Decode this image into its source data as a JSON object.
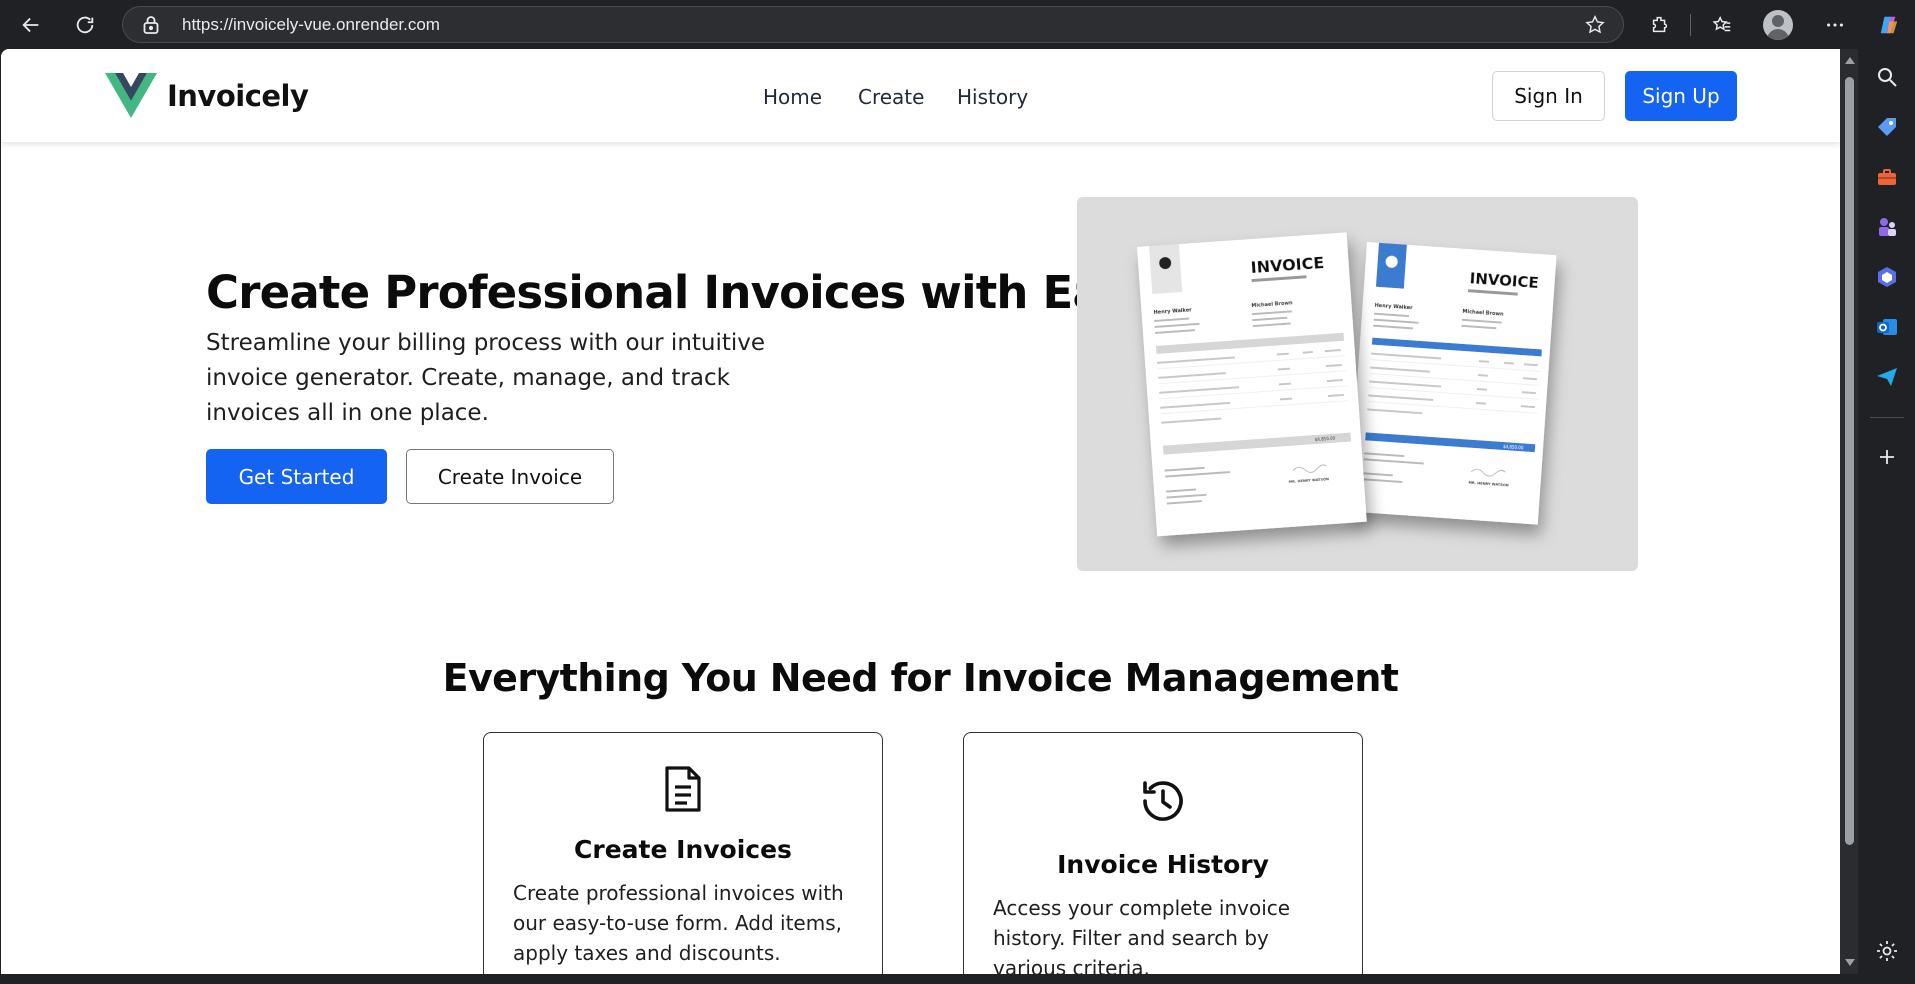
{
  "browser": {
    "url": "https://invoicely-vue.onrender.com"
  },
  "header": {
    "brand": "Invoicely",
    "nav": [
      "Home",
      "Create",
      "History"
    ],
    "sign_in": "Sign In",
    "sign_up": "Sign Up"
  },
  "hero": {
    "title": "Create Professional Invoices with Ease",
    "subtitle": "Streamline your billing process with our intuitive invoice generator. Create, manage, and track invoices all in one place.",
    "primary_button": "Get Started",
    "secondary_button": "Create Invoice",
    "image": {
      "doc_left": {
        "heading": "INVOICE",
        "to_name": "Henry Walker",
        "from_name": "Michael Brown",
        "grand_total": "$4,850.00",
        "signature": "MR. HENRY WATSON"
      },
      "doc_right": {
        "heading": "INVOICE",
        "to_name": "Henry Walker",
        "from_name": "Michael Brown",
        "grand_total": "$4,850.00",
        "signature": "MR. HENRY WATSON"
      }
    }
  },
  "features": {
    "title": "Everything You Need for Invoice Management",
    "cards": [
      {
        "title": "Create Invoices",
        "text": "Create professional invoices with our easy-to-use form. Add items, apply taxes and discounts."
      },
      {
        "title": "Invoice History",
        "text": "Access your complete invoice history. Filter and search by various criteria."
      }
    ]
  },
  "colors": {
    "primary": "#1463f3",
    "logo_green": "#41b883",
    "logo_dark": "#34495e",
    "invoice_accent": "#3b7bd1"
  }
}
